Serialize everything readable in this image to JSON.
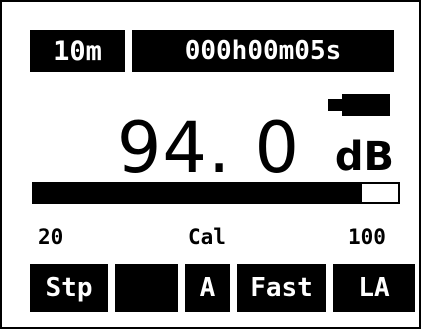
{
  "header": {
    "range": "10m",
    "elapsed": "000h00m05s"
  },
  "battery": {
    "icon": "battery-icon",
    "level": 1.0
  },
  "reading": {
    "value": "94. 0",
    "unit": "dB"
  },
  "bar": {
    "scale_min": "20",
    "scale_mid": "Cal",
    "scale_max": "100",
    "fill_fraction": 0.9
  },
  "softkeys": {
    "stop": "Stp",
    "blank": "",
    "weighting": "A",
    "time_weighting": "Fast",
    "parameter": "LA"
  },
  "colors": {
    "background": "#ffffff",
    "foreground": "#000000"
  }
}
